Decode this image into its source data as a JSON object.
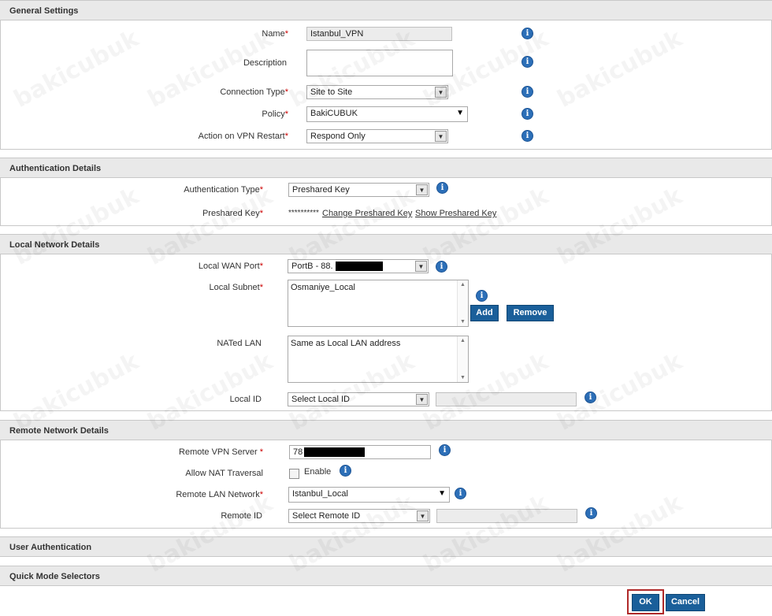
{
  "general": {
    "title": "General Settings",
    "name_label": "Name",
    "name_value": "Istanbul_VPN",
    "description_label": "Description",
    "description_value": "",
    "connection_type_label": "Connection Type",
    "connection_type_value": "Site to Site",
    "policy_label": "Policy",
    "policy_value": "BakiCUBUK",
    "action_label": "Action on VPN Restart",
    "action_value": "Respond Only"
  },
  "auth": {
    "title": "Authentication Details",
    "type_label": "Authentication Type",
    "type_value": "Preshared Key",
    "key_label": "Preshared Key",
    "key_mask": "**********",
    "change_link": "Change Preshared Key",
    "show_link": "Show Preshared Key"
  },
  "local": {
    "title": "Local Network Details",
    "wan_label": "Local WAN Port",
    "wan_value": "PortB - 88.",
    "subnet_label": "Local Subnet",
    "subnet_value": "Osmaniye_Local",
    "add_button": "Add",
    "remove_button": "Remove",
    "nated_label": "NATed LAN",
    "nated_value": "Same as Local LAN address",
    "id_label": "Local ID",
    "id_value": "Select Local ID"
  },
  "remote": {
    "title": "Remote Network Details",
    "server_label": "Remote VPN Server ",
    "server_value": "78",
    "nat_label": "Allow NAT Traversal",
    "nat_enable": "Enable",
    "lan_label": "Remote LAN Network",
    "lan_value": "Istanbul_Local",
    "id_label": "Remote ID",
    "id_value": "Select Remote ID"
  },
  "user_auth": {
    "title": "User Authentication"
  },
  "quick_mode": {
    "title": "Quick Mode Selectors"
  },
  "footer": {
    "ok": "OK",
    "cancel": "Cancel"
  },
  "required_mark": "*",
  "info_glyph": "i",
  "watermark": "bakicubuk",
  "colors": {
    "button_blue": "#1a5f9a",
    "info_blue": "#2c6fb8",
    "required_red": "#cc0000",
    "ok_highlight": "#b02a2a",
    "header_gray": "#e9e9e9"
  }
}
